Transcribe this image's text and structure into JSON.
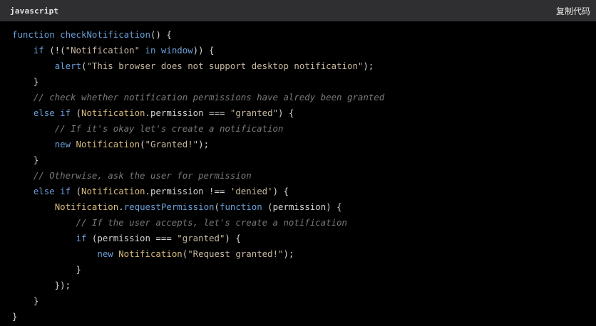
{
  "header": {
    "language": "javascript",
    "copy_label": "复制代码"
  },
  "code": {
    "lines": [
      [
        {
          "t": "kw",
          "v": "function"
        },
        {
          "t": "pl",
          "v": " "
        },
        {
          "t": "fn",
          "v": "checkNotification"
        },
        {
          "t": "pl",
          "v": "() {"
        }
      ],
      [
        {
          "t": "pl",
          "v": "    "
        },
        {
          "t": "kw",
          "v": "if"
        },
        {
          "t": "pl",
          "v": " (!("
        },
        {
          "t": "str",
          "v": "\"Notification\""
        },
        {
          "t": "pl",
          "v": " "
        },
        {
          "t": "kw",
          "v": "in"
        },
        {
          "t": "pl",
          "v": " "
        },
        {
          "t": "kw",
          "v": "window"
        },
        {
          "t": "pl",
          "v": ")) {"
        }
      ],
      [
        {
          "t": "pl",
          "v": "        "
        },
        {
          "t": "fn",
          "v": "alert"
        },
        {
          "t": "pl",
          "v": "("
        },
        {
          "t": "str",
          "v": "\"This browser does not support desktop notification\""
        },
        {
          "t": "pl",
          "v": ");"
        }
      ],
      [
        {
          "t": "pl",
          "v": "    }"
        }
      ],
      [
        {
          "t": "pl",
          "v": "    "
        },
        {
          "t": "cm",
          "v": "// check whether notification permissions have alredy been granted"
        }
      ],
      [
        {
          "t": "pl",
          "v": "    "
        },
        {
          "t": "kw",
          "v": "else if"
        },
        {
          "t": "pl",
          "v": " ("
        },
        {
          "t": "cls",
          "v": "Notification"
        },
        {
          "t": "pl",
          "v": "."
        },
        {
          "t": "pl",
          "v": "permission === "
        },
        {
          "t": "str",
          "v": "\"granted\""
        },
        {
          "t": "pl",
          "v": ") {"
        }
      ],
      [
        {
          "t": "pl",
          "v": "        "
        },
        {
          "t": "cm",
          "v": "// If it's okay let's create a notification"
        }
      ],
      [
        {
          "t": "pl",
          "v": "        "
        },
        {
          "t": "kw",
          "v": "new"
        },
        {
          "t": "pl",
          "v": " "
        },
        {
          "t": "cls",
          "v": "Notification"
        },
        {
          "t": "pl",
          "v": "("
        },
        {
          "t": "str",
          "v": "\"Granted!\""
        },
        {
          "t": "pl",
          "v": ");"
        }
      ],
      [
        {
          "t": "pl",
          "v": "    }"
        }
      ],
      [
        {
          "t": "pl",
          "v": "    "
        },
        {
          "t": "cm",
          "v": "// Otherwise, ask the user for permission"
        }
      ],
      [
        {
          "t": "pl",
          "v": "    "
        },
        {
          "t": "kw",
          "v": "else if"
        },
        {
          "t": "pl",
          "v": " ("
        },
        {
          "t": "cls",
          "v": "Notification"
        },
        {
          "t": "pl",
          "v": "."
        },
        {
          "t": "pl",
          "v": "permission !== "
        },
        {
          "t": "str",
          "v": "'denied'"
        },
        {
          "t": "pl",
          "v": ") {"
        }
      ],
      [
        {
          "t": "pl",
          "v": "        "
        },
        {
          "t": "cls",
          "v": "Notification"
        },
        {
          "t": "pl",
          "v": "."
        },
        {
          "t": "fn",
          "v": "requestPermission"
        },
        {
          "t": "pl",
          "v": "("
        },
        {
          "t": "kw",
          "v": "function"
        },
        {
          "t": "pl",
          "v": " (permission) {"
        }
      ],
      [
        {
          "t": "pl",
          "v": "            "
        },
        {
          "t": "cm",
          "v": "// If the user accepts, let's create a notification"
        }
      ],
      [
        {
          "t": "pl",
          "v": "            "
        },
        {
          "t": "kw",
          "v": "if"
        },
        {
          "t": "pl",
          "v": " (permission === "
        },
        {
          "t": "str",
          "v": "\"granted\""
        },
        {
          "t": "pl",
          "v": ") {"
        }
      ],
      [
        {
          "t": "pl",
          "v": "                "
        },
        {
          "t": "kw",
          "v": "new"
        },
        {
          "t": "pl",
          "v": " "
        },
        {
          "t": "cls",
          "v": "Notification"
        },
        {
          "t": "pl",
          "v": "("
        },
        {
          "t": "str",
          "v": "\"Request granted!\""
        },
        {
          "t": "pl",
          "v": ");"
        }
      ],
      [
        {
          "t": "pl",
          "v": "            }"
        }
      ],
      [
        {
          "t": "pl",
          "v": "        });"
        }
      ],
      [
        {
          "t": "pl",
          "v": "    }"
        }
      ],
      [
        {
          "t": "pl",
          "v": "}"
        }
      ]
    ]
  },
  "colors": {
    "background": "#000000",
    "header_background": "#2f2f31",
    "keyword": "#6a9fd8",
    "class_name": "#d7ba7d",
    "string": "#c7b8a0",
    "comment": "#7a7a7a",
    "plain": "#d4d4d4"
  }
}
